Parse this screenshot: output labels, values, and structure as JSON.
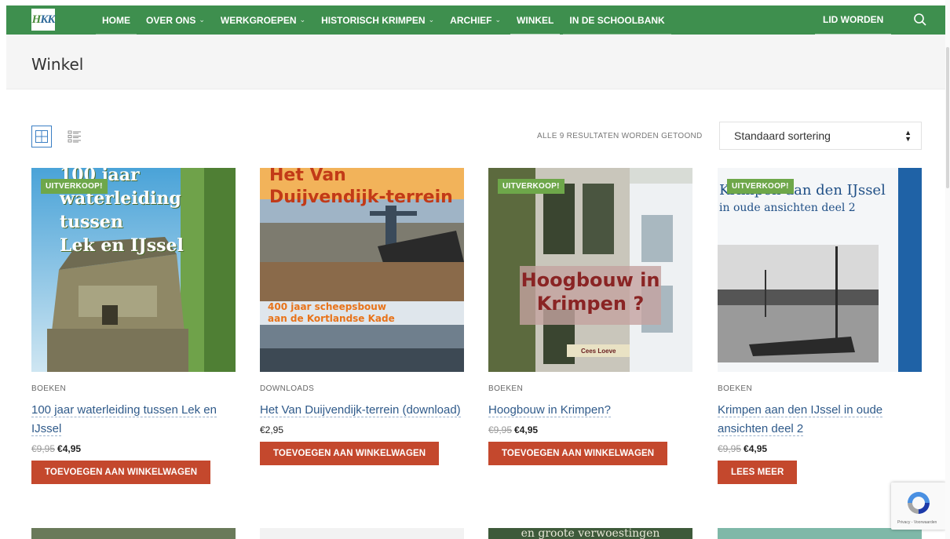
{
  "header": {
    "logo_text": "HKK",
    "nav": [
      {
        "label": "HOME",
        "has_dropdown": false
      },
      {
        "label": "OVER ONS",
        "has_dropdown": true
      },
      {
        "label": "WERKGROEPEN",
        "has_dropdown": true
      },
      {
        "label": "HISTORISCH KRIMPEN",
        "has_dropdown": true
      },
      {
        "label": "ARCHIEF",
        "has_dropdown": true
      },
      {
        "label": "WINKEL",
        "has_dropdown": false
      },
      {
        "label": "IN DE SCHOOLBANK",
        "has_dropdown": false
      }
    ],
    "cta_label": "LID WORDEN",
    "accent_color": "#3e8f4e"
  },
  "page": {
    "title": "Winkel"
  },
  "toolbar": {
    "result_count": "ALLE 9 RESULTATEN WORDEN GETOOND",
    "sort_selected": "Standaard sortering"
  },
  "products": [
    {
      "category": "BOEKEN",
      "title": "100 jaar waterleiding tussen Lek en IJssel",
      "old_price": "€9,95",
      "price": "€4,95",
      "badge": "UITVERKOOP!",
      "button": "TOEVOEGEN AAN WINKELWAGEN",
      "cover_text": [
        "100 jaar",
        "waterleiding",
        "tussen",
        "Lek en IJssel"
      ]
    },
    {
      "category": "DOWNLOADS",
      "title": "Het Van Duijvendijk-terrein (download)",
      "old_price": "",
      "price": "€2,95",
      "badge": "",
      "button": "TOEVOEGEN AAN WINKELWAGEN",
      "cover_text": [
        "Het Van",
        "Duijvendijk-terrein",
        "400 jaar scheepsbouw",
        "aan de Kortlandse Kade"
      ]
    },
    {
      "category": "BOEKEN",
      "title": "Hoogbouw in Krimpen?",
      "old_price": "€9,95",
      "price": "€4,95",
      "badge": "UITVERKOOP!",
      "button": "TOEVOEGEN AAN WINKELWAGEN",
      "cover_text": [
        "Hoogbouw in",
        "Krimpen ?",
        "Cees Loeve"
      ]
    },
    {
      "category": "BOEKEN",
      "title": "Krimpen aan den IJssel in oude ansichten deel 2",
      "old_price": "€9,95",
      "price": "€4,95",
      "badge": "UITVERKOOP!",
      "button": "LEES MEER",
      "cover_text": [
        "Krimpen aan den IJssel",
        "in oude ansichten deel 2"
      ]
    }
  ],
  "bottom_row_partial_text": "en groote verwoestingen",
  "recaptcha": {
    "text": "Privacy - Voorwaarden"
  },
  "colors": {
    "button": "#c4482d",
    "badge": "#6ea74a",
    "link": "#2f5a8a"
  }
}
